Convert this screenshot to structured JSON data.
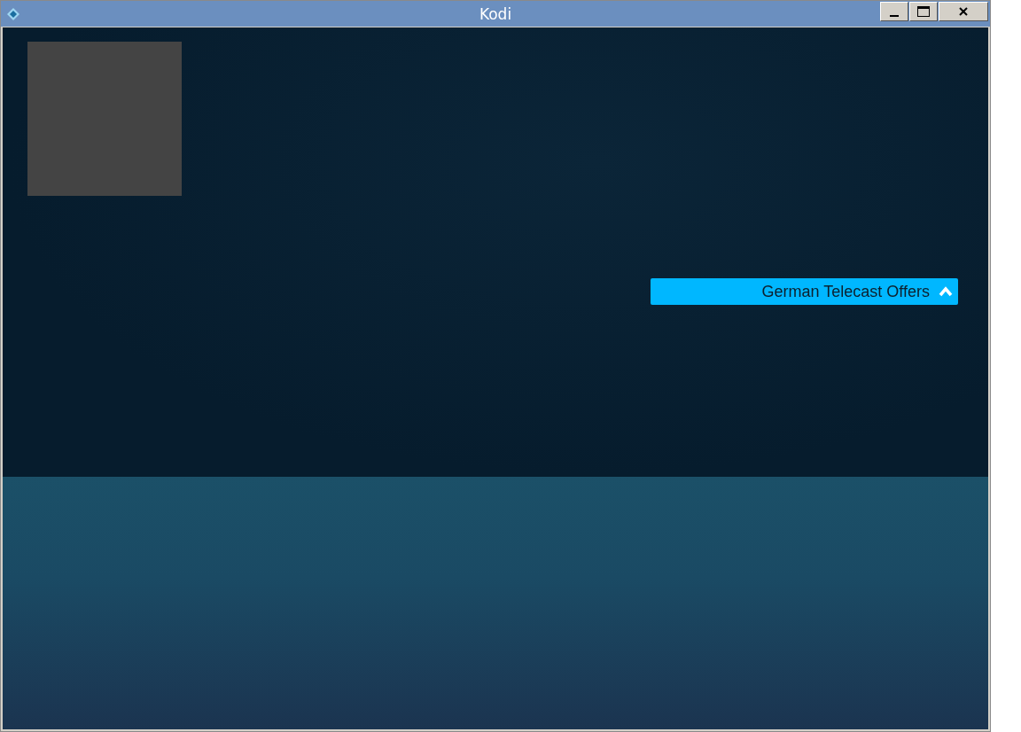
{
  "window": {
    "title": "Kodi"
  },
  "focused_item": {
    "label": "German Telecast Offers",
    "selected": true
  }
}
